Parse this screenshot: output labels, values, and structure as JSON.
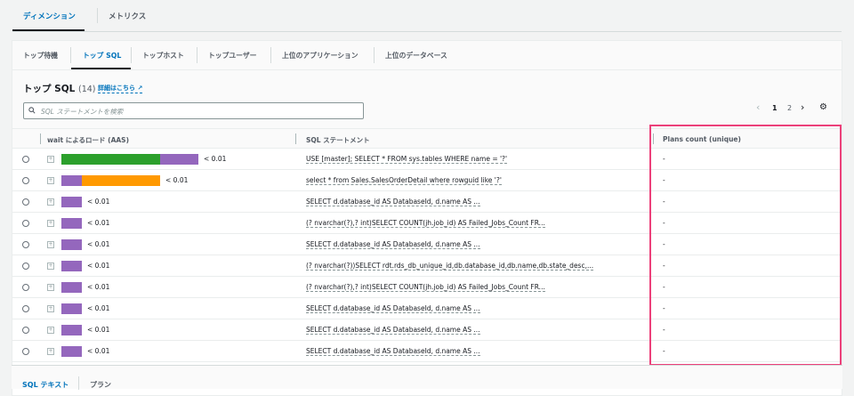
{
  "top_tabs": [
    {
      "label": "ディメンション",
      "active": true
    },
    {
      "label": "メトリクス",
      "active": false
    }
  ],
  "inner_tabs": [
    {
      "label": "トップ待機"
    },
    {
      "label": "トップ SQL",
      "active": true
    },
    {
      "label": "トップホスト"
    },
    {
      "label": "トップユーザー"
    },
    {
      "label": "上位のアプリケーション"
    },
    {
      "label": "上位のデータベース"
    }
  ],
  "section": {
    "title": "トップ SQL",
    "count": "(14)",
    "link": "詳細はこちら"
  },
  "search": {
    "placeholder": "SQL ステートメントを検索"
  },
  "pagination": {
    "pages": [
      "1",
      "2"
    ],
    "current": "1"
  },
  "columns": [
    "wait によるロード (AAS)",
    "SQL ステートメント",
    "Plans count (unique)"
  ],
  "colors": {
    "green": "#2ca02c",
    "purple": "#9467bd",
    "orange": "#ff9900",
    "highlight": "#ec407a",
    "accent": "#0073bb"
  },
  "rows": [
    {
      "segments": [
        {
          "color": "green",
          "value": 4.9
        },
        {
          "color": "purple",
          "value": 1.9
        }
      ],
      "load": "< 0.01",
      "sql": "USE [master]; SELECT * FROM sys.tables WHERE name = '?'",
      "plans": "-"
    },
    {
      "segments": [
        {
          "color": "purple",
          "value": 1
        },
        {
          "color": "orange",
          "value": 3.9
        }
      ],
      "load": "< 0.01",
      "sql": "select * from Sales.SalesOrderDetail where rowguid like '?'",
      "plans": "-"
    },
    {
      "segments": [
        {
          "color": "purple",
          "value": 1
        }
      ],
      "load": "< 0.01",
      "sql": "SELECT d.database_id AS DatabaseId, d.name AS ...",
      "plans": "-"
    },
    {
      "segments": [
        {
          "color": "purple",
          "value": 1
        }
      ],
      "load": "< 0.01",
      "sql": "(? nvarchar(?),? int)SELECT COUNT(jh.job_id) AS Failed_Jobs_Count FR...",
      "plans": "-"
    },
    {
      "segments": [
        {
          "color": "purple",
          "value": 1
        }
      ],
      "load": "< 0.01",
      "sql": "SELECT d.database_id AS DatabaseId, d.name AS ...",
      "plans": "-"
    },
    {
      "segments": [
        {
          "color": "purple",
          "value": 1
        }
      ],
      "load": "< 0.01",
      "sql": "(? nvarchar(?))SELECT rdt.rds_db_unique_id,db.database_id,db.name,db.state_desc,...",
      "plans": "-"
    },
    {
      "segments": [
        {
          "color": "purple",
          "value": 1
        }
      ],
      "load": "< 0.01",
      "sql": "(? nvarchar(?),? int)SELECT COUNT(jh.job_id) AS Failed_Jobs_Count FR...",
      "plans": "-"
    },
    {
      "segments": [
        {
          "color": "purple",
          "value": 1
        }
      ],
      "load": "< 0.01",
      "sql": "SELECT d.database_id AS DatabaseId, d.name AS ...",
      "plans": "-"
    },
    {
      "segments": [
        {
          "color": "purple",
          "value": 1
        }
      ],
      "load": "< 0.01",
      "sql": "SELECT d.database_id AS DatabaseId, d.name AS ...",
      "plans": "-"
    },
    {
      "segments": [
        {
          "color": "purple",
          "value": 1
        }
      ],
      "load": "< 0.01",
      "sql": "SELECT d.database_id AS DatabaseId, d.name AS ...",
      "plans": "-"
    }
  ],
  "bottom_tabs": [
    {
      "label": "SQL テキスト",
      "active": true
    },
    {
      "label": "プラン"
    }
  ]
}
